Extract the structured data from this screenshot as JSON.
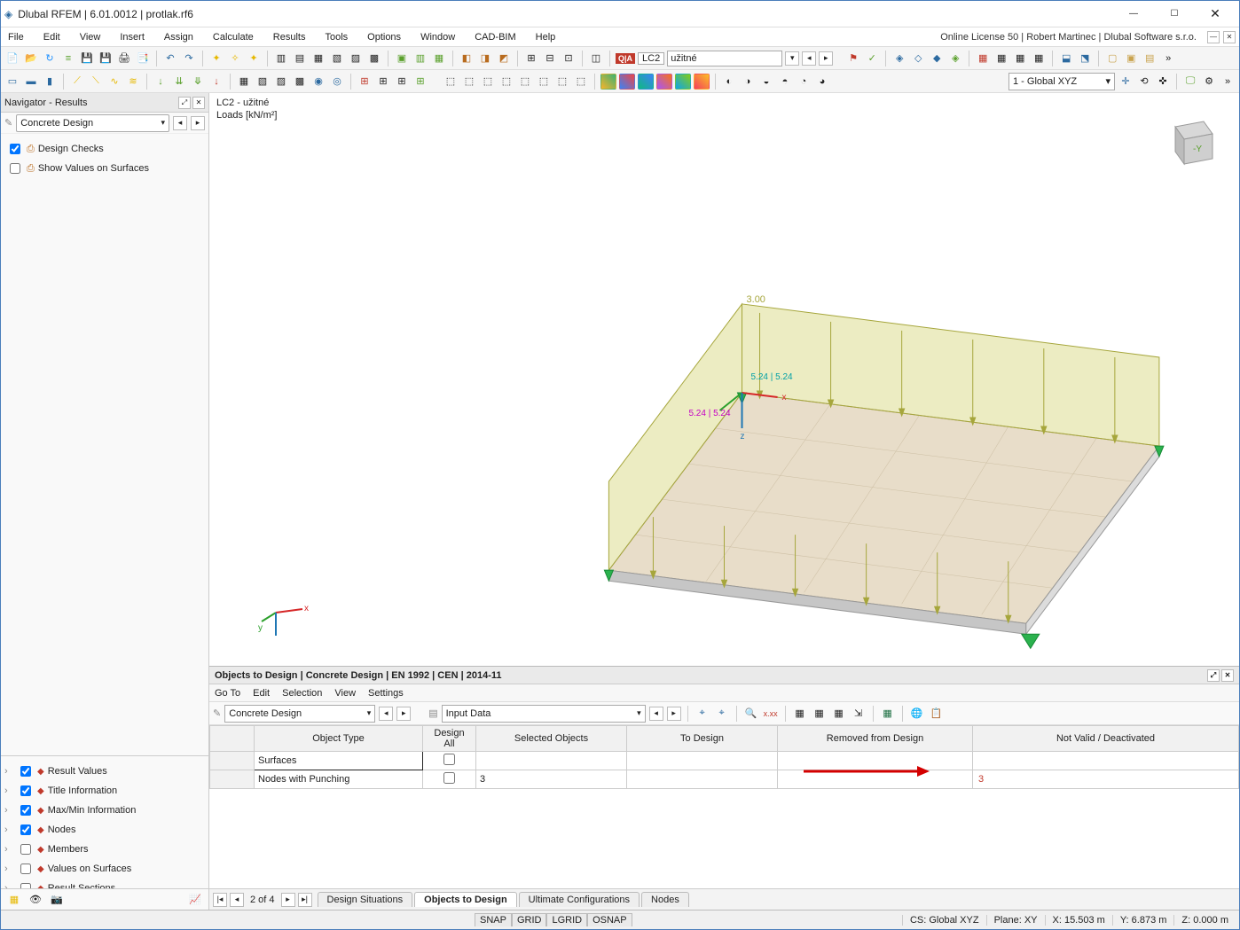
{
  "title": "Dlubal RFEM | 6.01.0012 | protlak.rf6",
  "license_info": "Online License 50 | Robert Martinec | Dlubal Software s.r.o.",
  "menus": [
    "File",
    "Edit",
    "View",
    "Insert",
    "Assign",
    "Calculate",
    "Results",
    "Tools",
    "Options",
    "Window",
    "CAD-BIM",
    "Help"
  ],
  "toolbar1": {
    "lc_badges": [
      "Q|A"
    ],
    "lc_code": "LC2",
    "lc_name": "užitné",
    "coord_dropdown": "1 - Global XYZ"
  },
  "navigator": {
    "title": "Navigator - Results",
    "combo": "Concrete Design",
    "upper_items": [
      {
        "label": "Design Checks",
        "checked": true
      },
      {
        "label": "Show Values on Surfaces",
        "checked": false
      }
    ],
    "lower_items": [
      {
        "label": "Result Values",
        "checked": true
      },
      {
        "label": "Title Information",
        "checked": true
      },
      {
        "label": "Max/Min Information",
        "checked": true
      },
      {
        "label": "Nodes",
        "checked": true
      },
      {
        "label": "Members",
        "checked": false
      },
      {
        "label": "Values on Surfaces",
        "checked": false
      },
      {
        "label": "Result Sections",
        "checked": false
      }
    ]
  },
  "viewport": {
    "line1": "LC2 - užitné",
    "line2": "Loads [kN/m²]",
    "load_top": "3.00",
    "annot1": "5.24 | 5.24",
    "annot2": "5.24",
    "axes": {
      "x": "x",
      "y": "y",
      "z": "z"
    },
    "cube_face": "-Y"
  },
  "bottom_panel": {
    "title": "Objects to Design | Concrete Design | EN 1992 | CEN | 2014-11",
    "menus": [
      "Go To",
      "Edit",
      "Selection",
      "View",
      "Settings"
    ],
    "combo1": "Concrete Design",
    "combo2": "Input Data",
    "columns": [
      "Object Type",
      "Design All",
      "Selected Objects",
      "To Design",
      "Removed from Design",
      "Not Valid / Deactivated"
    ],
    "rows": [
      {
        "objtype": "Surfaces",
        "design_all": false,
        "selected": "",
        "todesign": "",
        "removed": "",
        "notvalid": ""
      },
      {
        "objtype": "Nodes with Punching",
        "design_all": false,
        "selected": "3",
        "todesign": "",
        "removed": "",
        "notvalid": "3"
      }
    ],
    "tabs": [
      "Design Situations",
      "Objects to Design",
      "Ultimate Configurations",
      "Nodes"
    ],
    "active_tab": 1,
    "pager": "2 of 4"
  },
  "statusbar": {
    "snap_btns": [
      "SNAP",
      "GRID",
      "LGRID",
      "OSNAP"
    ],
    "cs": "CS: Global XYZ",
    "plane": "Plane: XY",
    "x": "X: 15.503 m",
    "y": "Y: 6.873 m",
    "z": "Z: 0.000 m"
  }
}
